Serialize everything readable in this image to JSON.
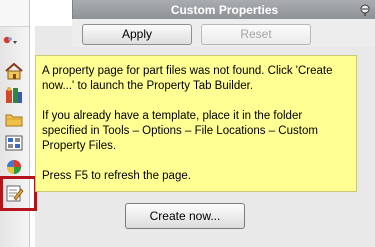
{
  "panel": {
    "title": "Custom Properties",
    "apply_label": "Apply",
    "reset_label": "Reset",
    "message": [
      "A property page for part files was not found. Click 'Create now...' to launch the Property Tab Builder.",
      "If you already have a template, place it in the folder specified in Tools – Options – File Locations – Custom Property Files.",
      "Press F5 to refresh the page."
    ],
    "create_label": "Create now..."
  },
  "toolbar_strip": {
    "icons": [
      "home-icon",
      "design-library-icon",
      "folder-icon",
      "view-palette-icon",
      "appearances-icon",
      "custom-properties-icon"
    ],
    "active": "custom-properties-icon",
    "highlight_color": "#b4141a"
  },
  "colors": {
    "note_background": "#ffff94",
    "titlebar": "#9b9ea2"
  }
}
